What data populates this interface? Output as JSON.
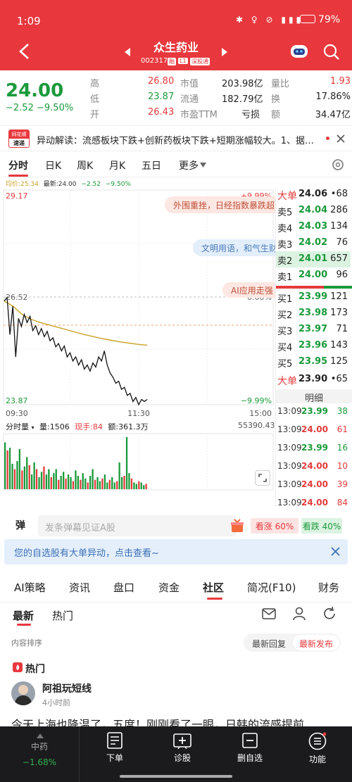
{
  "status_bar": {
    "time": "1:09",
    "battery": "79%"
  },
  "header": {
    "title": "众生药业",
    "code": "002317",
    "badges": [
      "融",
      "L1",
      "深股通"
    ]
  },
  "quote": {
    "price": "24.00",
    "change": "−2.52",
    "change_pct": "−9.50%",
    "fields": [
      {
        "label": "高",
        "value": "26.80",
        "label2": "市值",
        "value2": "203.98亿",
        "label3": "量比",
        "value3": "1.93"
      },
      {
        "label": "低",
        "value": "23.87",
        "label2": "流通",
        "value2": "182.79亿",
        "label3": "换",
        "value3": "17.86%"
      },
      {
        "label": "开",
        "value": "26.43",
        "label2": "市盈TTM",
        "value2": "亏损",
        "label3": "额",
        "value3": "34.47亿"
      }
    ]
  },
  "news": {
    "logo_top": "同花顺",
    "logo_bottom": "速递",
    "text": "异动解读：流感板块下跌+创新药板块下跌+短期涨幅较大。1、据…"
  },
  "period_tabs": [
    "分时",
    "日K",
    "周K",
    "月K",
    "五日",
    "更多"
  ],
  "chart_info": {
    "avg_label": "均价:25.34",
    "latest_label": "最新:24.00",
    "change": "−2.52",
    "pct": "−9.50%"
  },
  "chart_data": {
    "type": "line",
    "ylim": [
      23.87,
      29.17
    ],
    "y_labels": {
      "top": "29.17",
      "mid": "26.52",
      "bottom": "23.87"
    },
    "pct_labels": {
      "top": "+9.99%",
      "mid": "0.00%",
      "bottom": "−9.99%"
    },
    "x_labels": [
      "09:30",
      "11:30",
      "15:00"
    ],
    "series": [
      {
        "name": "最新",
        "values": [
          26.43,
          26.52,
          25.6,
          26.3,
          25.05,
          26.0,
          25.8,
          26.1,
          25.9,
          26.05,
          25.7,
          25.82,
          25.6,
          25.75,
          25.55,
          25.68,
          25.45,
          25.52,
          25.3,
          25.38,
          25.2,
          25.32,
          25.05,
          25.15,
          24.95,
          25.05,
          24.85,
          24.98,
          24.75,
          24.85,
          24.7,
          24.9,
          24.8,
          25.05,
          24.95,
          25.2,
          24.85,
          24.65,
          24.55,
          24.4,
          24.45,
          24.25,
          24.3,
          24.1,
          24.15,
          23.95,
          24.05,
          23.87,
          24.0,
          23.95,
          24.0
        ]
      },
      {
        "name": "均价",
        "values": [
          26.43,
          26.3,
          26.1,
          25.98,
          25.9,
          25.84,
          25.78,
          25.72,
          25.66,
          25.6,
          25.55,
          25.5,
          25.46,
          25.42,
          25.39,
          25.36,
          25.34
        ]
      }
    ],
    "volume_label": "分时量",
    "volume_info": {
      "vol": "量:1506",
      "now_label": "现手:84",
      "amount": "额:361.3万"
    },
    "volume_max": "55390.43"
  },
  "danmaku": {
    "items": [
      "外围重挫，日经指数暴跌超",
      "文明用语，和气生财",
      "AI应用走强"
    ]
  },
  "order_book": {
    "big_top": {
      "label": "大单",
      "price": "24.06",
      "vol": "•68"
    },
    "asks": [
      {
        "label": "卖5",
        "price": "24.04",
        "vol": "286"
      },
      {
        "label": "卖4",
        "price": "24.03",
        "vol": "134"
      },
      {
        "label": "卖3",
        "price": "24.02",
        "vol": "76"
      },
      {
        "label": "卖2",
        "price": "24.01",
        "vol": "657"
      },
      {
        "label": "卖1",
        "price": "24.00",
        "vol": "96"
      }
    ],
    "bids": [
      {
        "label": "买1",
        "price": "23.99",
        "vol": "121"
      },
      {
        "label": "买2",
        "price": "23.98",
        "vol": "173"
      },
      {
        "label": "买3",
        "price": "23.97",
        "vol": "71"
      },
      {
        "label": "买4",
        "price": "23.96",
        "vol": "143"
      },
      {
        "label": "买5",
        "price": "23.95",
        "vol": "125"
      }
    ],
    "big_bottom": {
      "label": "大单",
      "price": "23.90",
      "vol": "•65"
    }
  },
  "ticks": {
    "title": "明细",
    "rows": [
      {
        "time": "13:09",
        "price": "23.99",
        "vol": "38",
        "up": false
      },
      {
        "time": "13:09",
        "price": "24.00",
        "vol": "61",
        "up": true
      },
      {
        "time": "13:09",
        "price": "23.99",
        "vol": "16",
        "up": false
      },
      {
        "time": "13:09",
        "price": "24.00",
        "vol": "10",
        "up": true
      },
      {
        "time": "13:09",
        "price": "24.00",
        "vol": "39",
        "up": true
      },
      {
        "time": "13:09",
        "price": "24.00",
        "vol": "84",
        "up": true
      }
    ]
  },
  "comment_bar": {
    "icon": "弹",
    "placeholder": "发条弹幕见证A股",
    "bull": "看涨 60%",
    "bear": "看跌 40%"
  },
  "alert": {
    "text": "您的自选股有大单异动，点击查看~"
  },
  "section_tabs": [
    "AI策略",
    "资讯",
    "盘口",
    "资金",
    "社区",
    "简况(F10)",
    "财务"
  ],
  "community": {
    "subtabs": [
      "最新",
      "热门"
    ],
    "sort_label": "内容排序",
    "sort_options": [
      "最新回复",
      "最新发布"
    ],
    "hot_label": "热门",
    "post": {
      "user": "阿祖玩短线",
      "time": "4小时前",
      "text": "今天上海也降温了，五度！刚刚看了一眼，日韩的流感提前"
    }
  },
  "bottom_nav": {
    "stock": {
      "name": "中药",
      "pct": "−1.68%"
    },
    "items": [
      "下单",
      "诊股",
      "删自选",
      "功能"
    ]
  },
  "colors": {
    "brand": "#e8383d",
    "up": "#e43b3b",
    "down": "#1a9a3a",
    "avg": "#c9a227"
  }
}
